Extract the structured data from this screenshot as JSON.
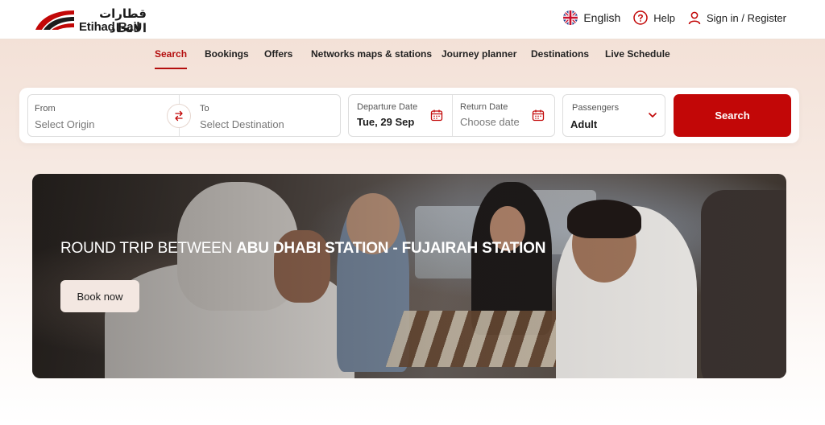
{
  "brand": {
    "name_ar": "قطارات الاتحاد",
    "name_en": "Etihad Rail",
    "accent_color": "#c20707"
  },
  "header": {
    "language": "English",
    "help": "Help",
    "sign_in": "Sign in / Register",
    "icons": [
      "uk-flag-icon",
      "help-circle-icon",
      "user-icon"
    ]
  },
  "nav": {
    "items": [
      {
        "label": "Search",
        "active": true
      },
      {
        "label": "Bookings",
        "active": false
      },
      {
        "label": "Offers",
        "active": false
      },
      {
        "label": "Networks maps & stations",
        "active": false
      },
      {
        "label": "Journey planner",
        "active": false
      },
      {
        "label": "Destinations",
        "active": false
      },
      {
        "label": "Live Schedule",
        "active": false
      }
    ]
  },
  "search": {
    "from_label": "From",
    "from_placeholder": "Select Origin",
    "to_label": "To",
    "to_placeholder": "Select Destination",
    "departure_label": "Departure Date",
    "departure_value": "Tue, 29 Sep",
    "return_label": "Return Date",
    "return_placeholder": "Choose date",
    "passengers_label": "Passengers",
    "passengers_value": "Adult",
    "button": "Search"
  },
  "banner": {
    "title_prefix": "ROUND TRIP BETWEEN ",
    "title_bold": "ABU DHABI STATION - FUJAIRAH STATION",
    "cta": "Book now"
  }
}
